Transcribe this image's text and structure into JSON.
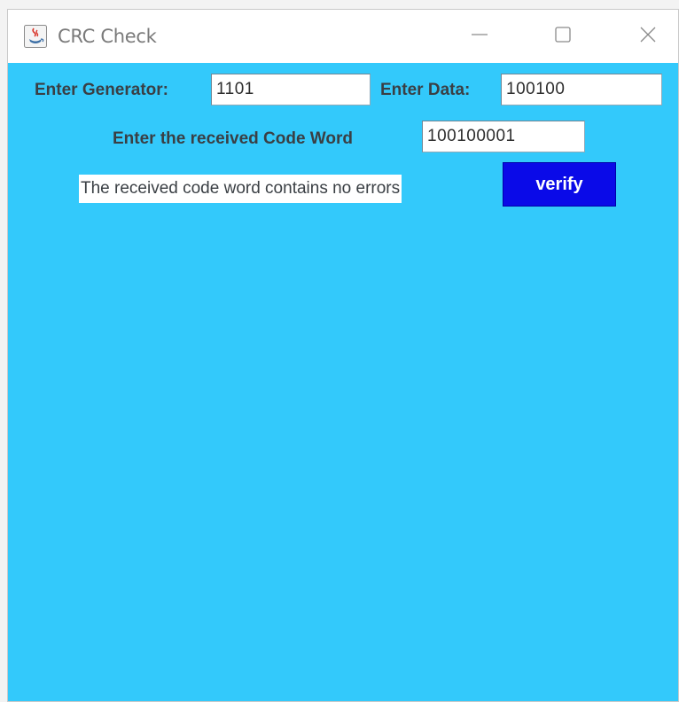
{
  "window": {
    "title": "CRC Check",
    "icon": "java-cup-icon",
    "controls": [
      "minimize-icon",
      "maximize-icon",
      "close-icon"
    ]
  },
  "form": {
    "generator_label": "Enter Generator:",
    "generator_value": "1101",
    "data_label": "Enter Data:",
    "data_value": "100100",
    "codeword_label": "Enter the received Code Word",
    "codeword_value": "100100001",
    "status_message": "The received code word contains no errors",
    "verify_label": "verify"
  },
  "colors": {
    "background": "#33c9fb",
    "button": "#0a0ae8",
    "button_text": "#ffffff"
  }
}
